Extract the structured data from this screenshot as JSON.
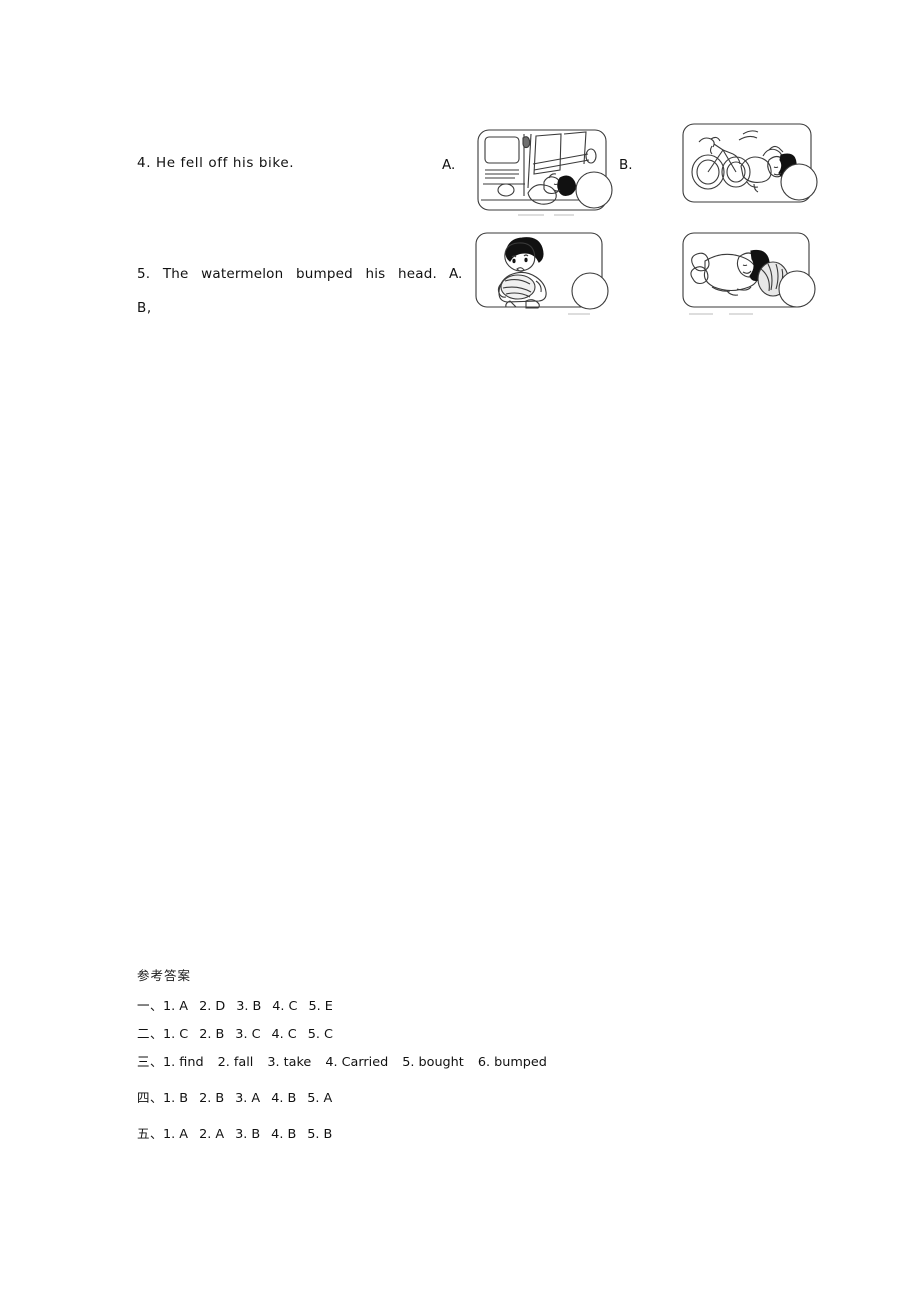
{
  "document": {
    "page_background": "#ffffff",
    "ink_color": "#111111"
  },
  "questions": [
    {
      "id": "q4",
      "number": "4.",
      "text": "4. He fell off his bike.",
      "options": [
        {
          "label": "A.",
          "picture": "boy-lying-in-front-of-bus"
        },
        {
          "label": "B.",
          "picture": "boy-falling-off-bike"
        }
      ]
    },
    {
      "id": "q5",
      "number": "5.",
      "text": "5. The watermelon bumped his head.",
      "option_b_trailing": "B,",
      "options": [
        {
          "label": "A.",
          "picture": "boy-carrying-watermelon"
        },
        {
          "label": "B.",
          "picture": "boy-lying-down-with-watermelon"
        }
      ]
    }
  ],
  "answer_key": {
    "title": "参考答案",
    "rows": [
      {
        "head": "一、",
        "items": [
          "1. A",
          "2. D",
          "3. B",
          "4. C",
          "5. E"
        ]
      },
      {
        "head": "二、",
        "items": [
          "1. C",
          "2. B",
          "3. C",
          "4. C",
          "5. C"
        ]
      },
      {
        "head": "三、",
        "items": [
          "1. find",
          "2. fall",
          "3. take",
          "4. Carried",
          "5. bought",
          "6. bumped"
        ]
      },
      {
        "head": "四、",
        "items": [
          "1. B",
          "2. B",
          "3. A",
          "4. B",
          "5. A"
        ]
      },
      {
        "head": "五、",
        "items": [
          "1. A",
          "2. A",
          "3. B",
          "4. B",
          "5. B"
        ]
      }
    ]
  }
}
